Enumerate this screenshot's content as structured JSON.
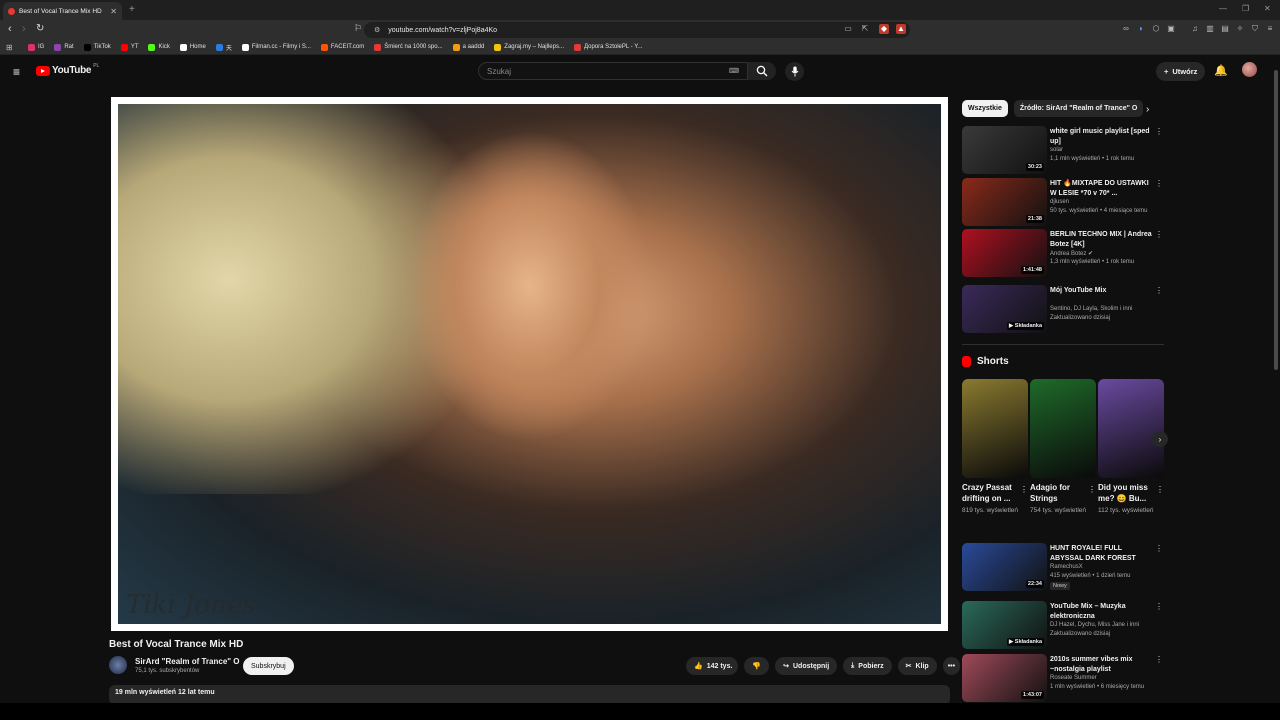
{
  "browser": {
    "tab_title": "Best of Vocal Trance Mix HD",
    "url": "youtube.com/watch?v=zljPoj8a4Ko",
    "bookmarks": [
      "IG",
      "Rat",
      "TikTok",
      "YT",
      "Kick",
      "Home",
      "天",
      "Filman.cc - Filmy i S...",
      "FACEIT.com",
      "Śmierć na 1000 spo...",
      "a aaddd",
      "Zagraj.my – Najlleps...",
      "Дорога SztolePL - Y..."
    ],
    "bookmark_colors": [
      "#e1306c",
      "#8e44ad",
      "#000000",
      "#ff0000",
      "#53fc18",
      "#ffffff",
      "#2a7ae2",
      "#ffffff",
      "#ff5500",
      "#e53935",
      "#f39c12",
      "#f1c40f",
      "#e53935"
    ]
  },
  "header": {
    "logo_text": "YouTube",
    "logo_region": "PL",
    "search_placeholder": "Szukaj",
    "create_label": "Utwórz"
  },
  "video": {
    "title": "Best of Vocal Trance Mix HD",
    "watermark": "Tiki Jones",
    "channel_name": "SirArd \"Realm of Trance\" O",
    "subscribers": "75,1 tys. subskrybentów",
    "subscribe_label": "Subskrybuj",
    "likes": "142 tys.",
    "share_label": "Udostępnij",
    "download_label": "Pobierz",
    "clip_label": "Klip",
    "views_date": "19 mln wyświetleń  12 lat temu"
  },
  "chips": [
    "Wszystkie",
    "Źródło: SirArd \"Realm of Trance\" O"
  ],
  "recommendations_top": [
    {
      "title": "white girl music playlist [sped up]",
      "channel": "solar",
      "meta": "1,1 mln wyświetleń • 1 rok temu",
      "duration": "30:23",
      "thumb": "#3a3a3a"
    },
    {
      "title": "HIT 🔥MIXTAPE DO USTAWKI W LESIE *70 v 70* ...",
      "channel": "djlusen",
      "meta": "50 tys. wyświetleń • 4 miesiące temu",
      "duration": "21:38",
      "thumb": "#8a2a1a"
    },
    {
      "title": "BERLIN TECHNO MIX | Andrea Botez [4K]",
      "channel": "Andrea Botez ✔",
      "meta": "1,3 mln wyświetleń • 1 rok temu",
      "duration": "1:41:48",
      "thumb": "#b01020"
    },
    {
      "title": "Mój YouTube Mix",
      "channel": "Sentino, DJ Layla, Skolim i inni",
      "meta": "Zaktualizowano dzisiaj",
      "duration": "▶ Składanka",
      "thumb": "#3a2a5a"
    }
  ],
  "shorts": {
    "heading": "Shorts",
    "items": [
      {
        "title": "Crazy Passat drifting on ...",
        "views": "819 tys. wyświetleń",
        "thumb": "#8a7a30"
      },
      {
        "title": "Adagio for Strings",
        "views": "754 tys. wyświetleń",
        "thumb": "#1f6a2a"
      },
      {
        "title": "Did you miss me? 😄 Bu...",
        "views": "112 tys. wyświetleń",
        "thumb": "#6a4aa0"
      }
    ]
  },
  "recommendations_bottom": [
    {
      "title": "HUNT ROYALE! FULL ABYSSAL DARK FOREST SOLO GUIDE! ...",
      "channel": "RamechusX",
      "meta": "415 wyświetleń • 1 dzień temu",
      "badge": "Nowy",
      "duration": "22:34",
      "thumb": "#2a4a9a"
    },
    {
      "title": "YouTube Mix – Muzyka elektroniczna",
      "channel": "DJ Hazel, Dychu, Miss Jane i inni",
      "meta": "Zaktualizowano dzisiaj",
      "badge": "",
      "duration": "▶ Składanka",
      "thumb": "#2a6a5a"
    },
    {
      "title": "2010s summer vibes mix ~nostalgia playlist",
      "channel": "Roseate Summer",
      "meta": "1 mln wyświetleń • 6 miesięcy temu",
      "badge": "",
      "duration": "1:43:07",
      "thumb": "#a04a5a"
    }
  ]
}
